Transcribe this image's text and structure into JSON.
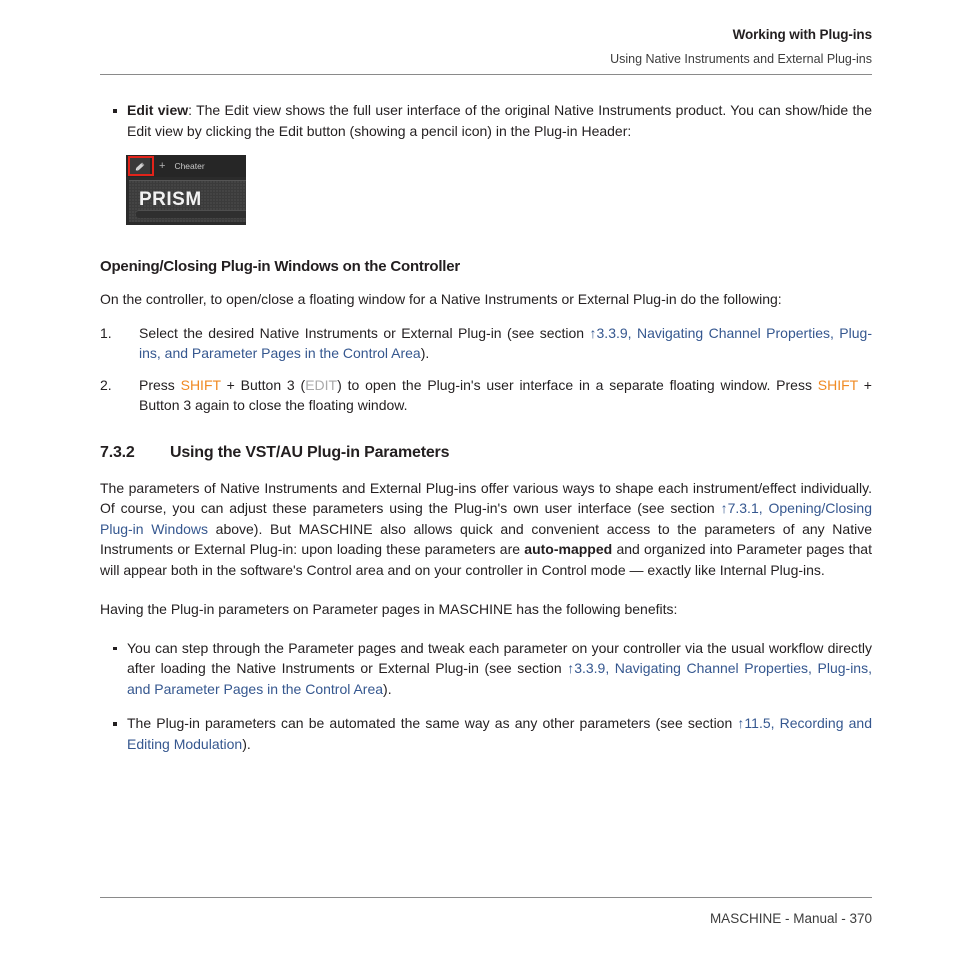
{
  "header": {
    "title": "Working with Plug-ins",
    "subtitle": "Using Native Instruments and External Plug-ins"
  },
  "bullet_edit_view": {
    "term": "Edit view",
    "rest": ": The Edit view shows the full user interface of the original Native Instruments product. You can show/hide the Edit view by clicking the Edit button (showing a pencil icon) in the Plug-in Header:"
  },
  "figure": {
    "pencil_icon": "pencil-icon",
    "plus": "+",
    "plugin_name": "Cheater",
    "logo": "PRISM"
  },
  "subheading": "Opening/Closing Plug-in Windows on the Controller",
  "intro_para": "On the controller, to open/close a floating window for a Native Instruments or External Plug-in do the following:",
  "steps": [
    {
      "number": "1.",
      "text_before": "Select the desired Native Instruments or External Plug-in (see section ",
      "link": "↑3.3.9, Navigating Channel Properties, Plug-ins, and Parameter Pages in the Control Area",
      "text_after": ")."
    },
    {
      "number": "2.",
      "p1": "Press ",
      "shift1": "SHIFT",
      "p2": " + Button 3 (",
      "edit": "EDIT",
      "p3": ") to open the Plug-in's user interface in a separate floating window. Press ",
      "shift2": "SHIFT",
      "p4": " + Button 3 again to close the floating window."
    }
  ],
  "section": {
    "number": "7.3.2",
    "title": "Using the VST/AU Plug-in Parameters"
  },
  "para_1": {
    "t1": "The parameters of Native Instruments and External Plug-ins offer various ways to shape each instrument/effect individually. Of course, you can adjust these parameters using the Plug-in's own user interface (see section ",
    "link": "↑7.3.1, Opening/Closing Plug-in Windows",
    "t2": " above). But MASCHINE also allows quick and convenient access to the parameters of any Native Instruments or External Plug-in: upon loading these parameters are ",
    "bold": "auto-mapped",
    "t3": " and organized into Parameter pages that will appear both in the software's Control area and on your controller in Control mode — exactly like Internal Plug-ins."
  },
  "para_2": "Having the Plug-in parameters on Parameter pages in MASCHINE has the following benefits:",
  "benefits": [
    {
      "t1": "You can step through the Parameter pages and tweak each parameter on your controller via the usual workflow directly after loading the Native Instruments or External Plug-in (see section ",
      "link": "↑3.3.9, Navigating Channel Properties, Plug-ins, and Parameter Pages in the Control Area",
      "t2": ")."
    },
    {
      "t1": "The Plug-in parameters can be automated the same way as any other parameters (see section ",
      "link": "↑11.5, Recording and Editing Modulation",
      "t2": ")."
    }
  ],
  "footer": "MASCHINE - Manual - 370",
  "colors": {
    "link": "#35578f",
    "shift": "#f08a22",
    "edit": "#a9a9a9",
    "highlight": "#e2231a",
    "text": "#231f20"
  }
}
